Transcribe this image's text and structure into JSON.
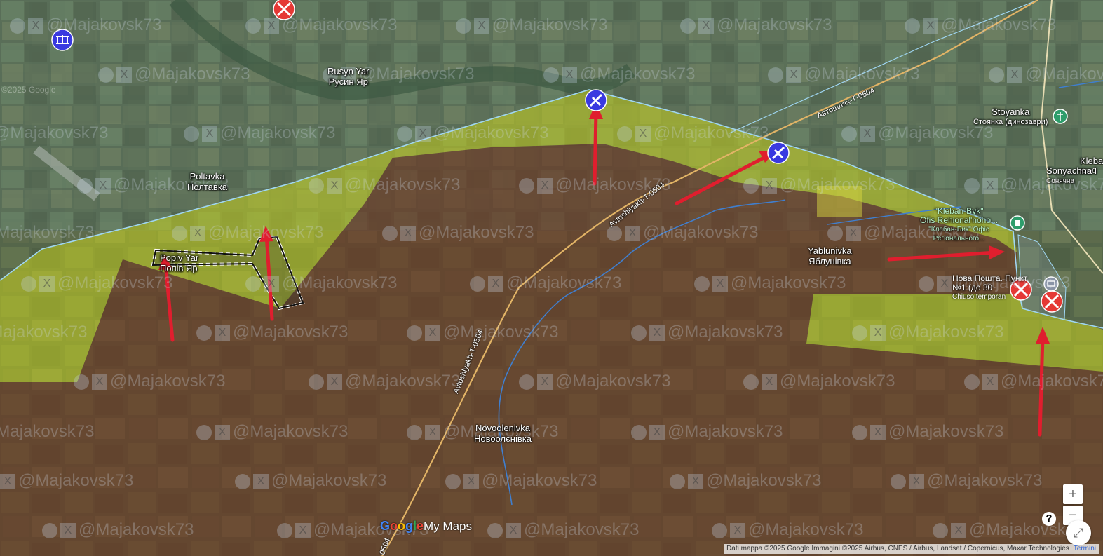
{
  "places": [
    {
      "id": "rusyn-yar",
      "name": "Rusyn Yar",
      "name_local": "Русин Яр"
    },
    {
      "id": "poltavka",
      "name": "Poltavka",
      "name_local": "Полтавка"
    },
    {
      "id": "popiv-yar",
      "name": "Popiv Yar",
      "name_local": "Попів Яр"
    },
    {
      "id": "yablunivka",
      "name": "Yablunivka",
      "name_local": "Яблунівка"
    },
    {
      "id": "novoolenivka",
      "name": "Novoolenivka",
      "name_local": "Новоолєнівка"
    },
    {
      "id": "stoyanka",
      "name": "Stoyanka",
      "name_local": "Стоянка (динозаври)"
    },
    {
      "id": "kleban",
      "name": "Kleba",
      "name_local": "Клеб"
    },
    {
      "id": "sonyachna",
      "name": "Sonyachna I",
      "name_local": "Сонячна"
    }
  ],
  "pois": [
    {
      "id": "kleban-byk",
      "line1": "\"Kleban-Byk\"",
      "line2": "Ofis Rehional'noho...",
      "line3": "\"Клебан-Бик\" Офіс",
      "line4": "Регіонального..."
    },
    {
      "id": "nova-poshta",
      "line1": "Нова Пошта. Пункт",
      "line2": "№1 (до 30",
      "line3": "Chiuso temporan"
    }
  ],
  "roads": [
    {
      "id": "t0504-top",
      "label": "Автошлях-Т-0504"
    },
    {
      "id": "t0504-mid",
      "label": "Avtoshlyakh-T-0504"
    },
    {
      "id": "t0504-low",
      "label": "Avtoshlyakh-T-0504"
    },
    {
      "id": "t0504-bottom",
      "label": "0504"
    }
  ],
  "watermark": {
    "text": "@Majakovsk73"
  },
  "copyright_faint": "©2025 Google",
  "zones": {
    "russian_controlled_color": "#6e3320",
    "contested_color": "#c6d21f",
    "line_color": "#9fd6f2",
    "encirclement_color": "#ffffff"
  },
  "markers": {
    "attack_arrow_color": "#e01e2e",
    "strike_icon_color": "#e53935",
    "air_icon_color": "#3a3ae0"
  },
  "controls": {
    "zoom_in": "+",
    "zoom_out": "−",
    "help": "?"
  },
  "logo": {
    "g1": "G",
    "g2": "o",
    "g3": "o",
    "g4": "g",
    "g5": "l",
    "g6": "e",
    "suffix": "My Maps"
  },
  "attribution": {
    "text": "Dati mappa ©2025 Google Immagini ©2025 Airbus, CNES / Airbus, Landsat / Copernicus, Maxar Technologies",
    "link": "Termini"
  }
}
